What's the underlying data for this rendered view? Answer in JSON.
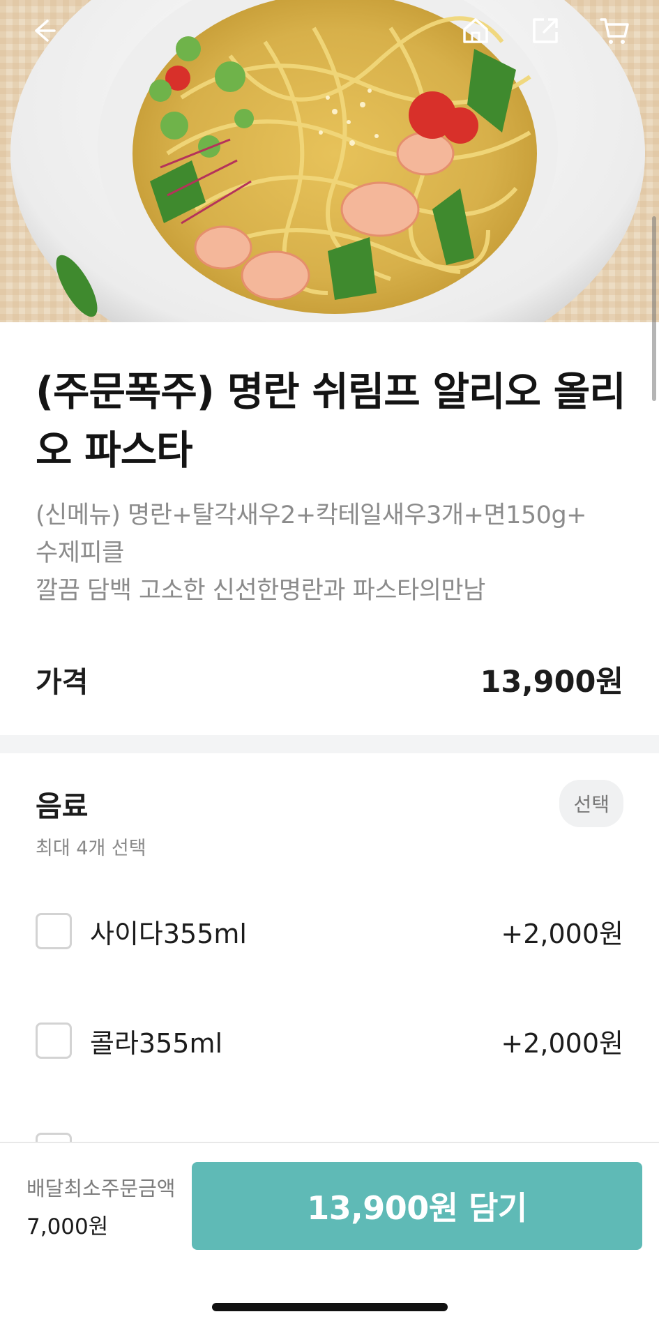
{
  "hero": {
    "image_alt": "명란 쉬림프 알리오 올리오 파스타",
    "icons": {
      "back": "arrow-left-icon",
      "home": "home-icon",
      "share": "share-icon",
      "cart": "cart-icon"
    }
  },
  "item": {
    "title": "(주문폭주) 명란 쉬림프 알리오 올리오 파스타",
    "description_lines": [
      "(신메뉴) 명란+탈각새우2+칵테일새우3개+면150g+",
      "수제피클",
      "깔끔 담백 고소한 신선한명란과 파스타의만남"
    ]
  },
  "price": {
    "label": "가격",
    "value": "13,900원"
  },
  "options": {
    "title": "음료",
    "badge": "선택",
    "subtitle": "최대 4개 선택",
    "items": [
      {
        "name": "사이다355ml",
        "price": "+2,000원",
        "checked": false
      },
      {
        "name": "콜라355ml",
        "price": "+2,000원",
        "checked": false
      }
    ]
  },
  "bottom": {
    "min_order_label": "배달최소주문금액",
    "min_order_value": "7,000원",
    "add_button_label": "13,900원 담기"
  },
  "colors": {
    "accent": "#5fbab6",
    "text": "#1c1c1c",
    "muted": "#8b8b8b",
    "band": "#f3f4f5"
  }
}
